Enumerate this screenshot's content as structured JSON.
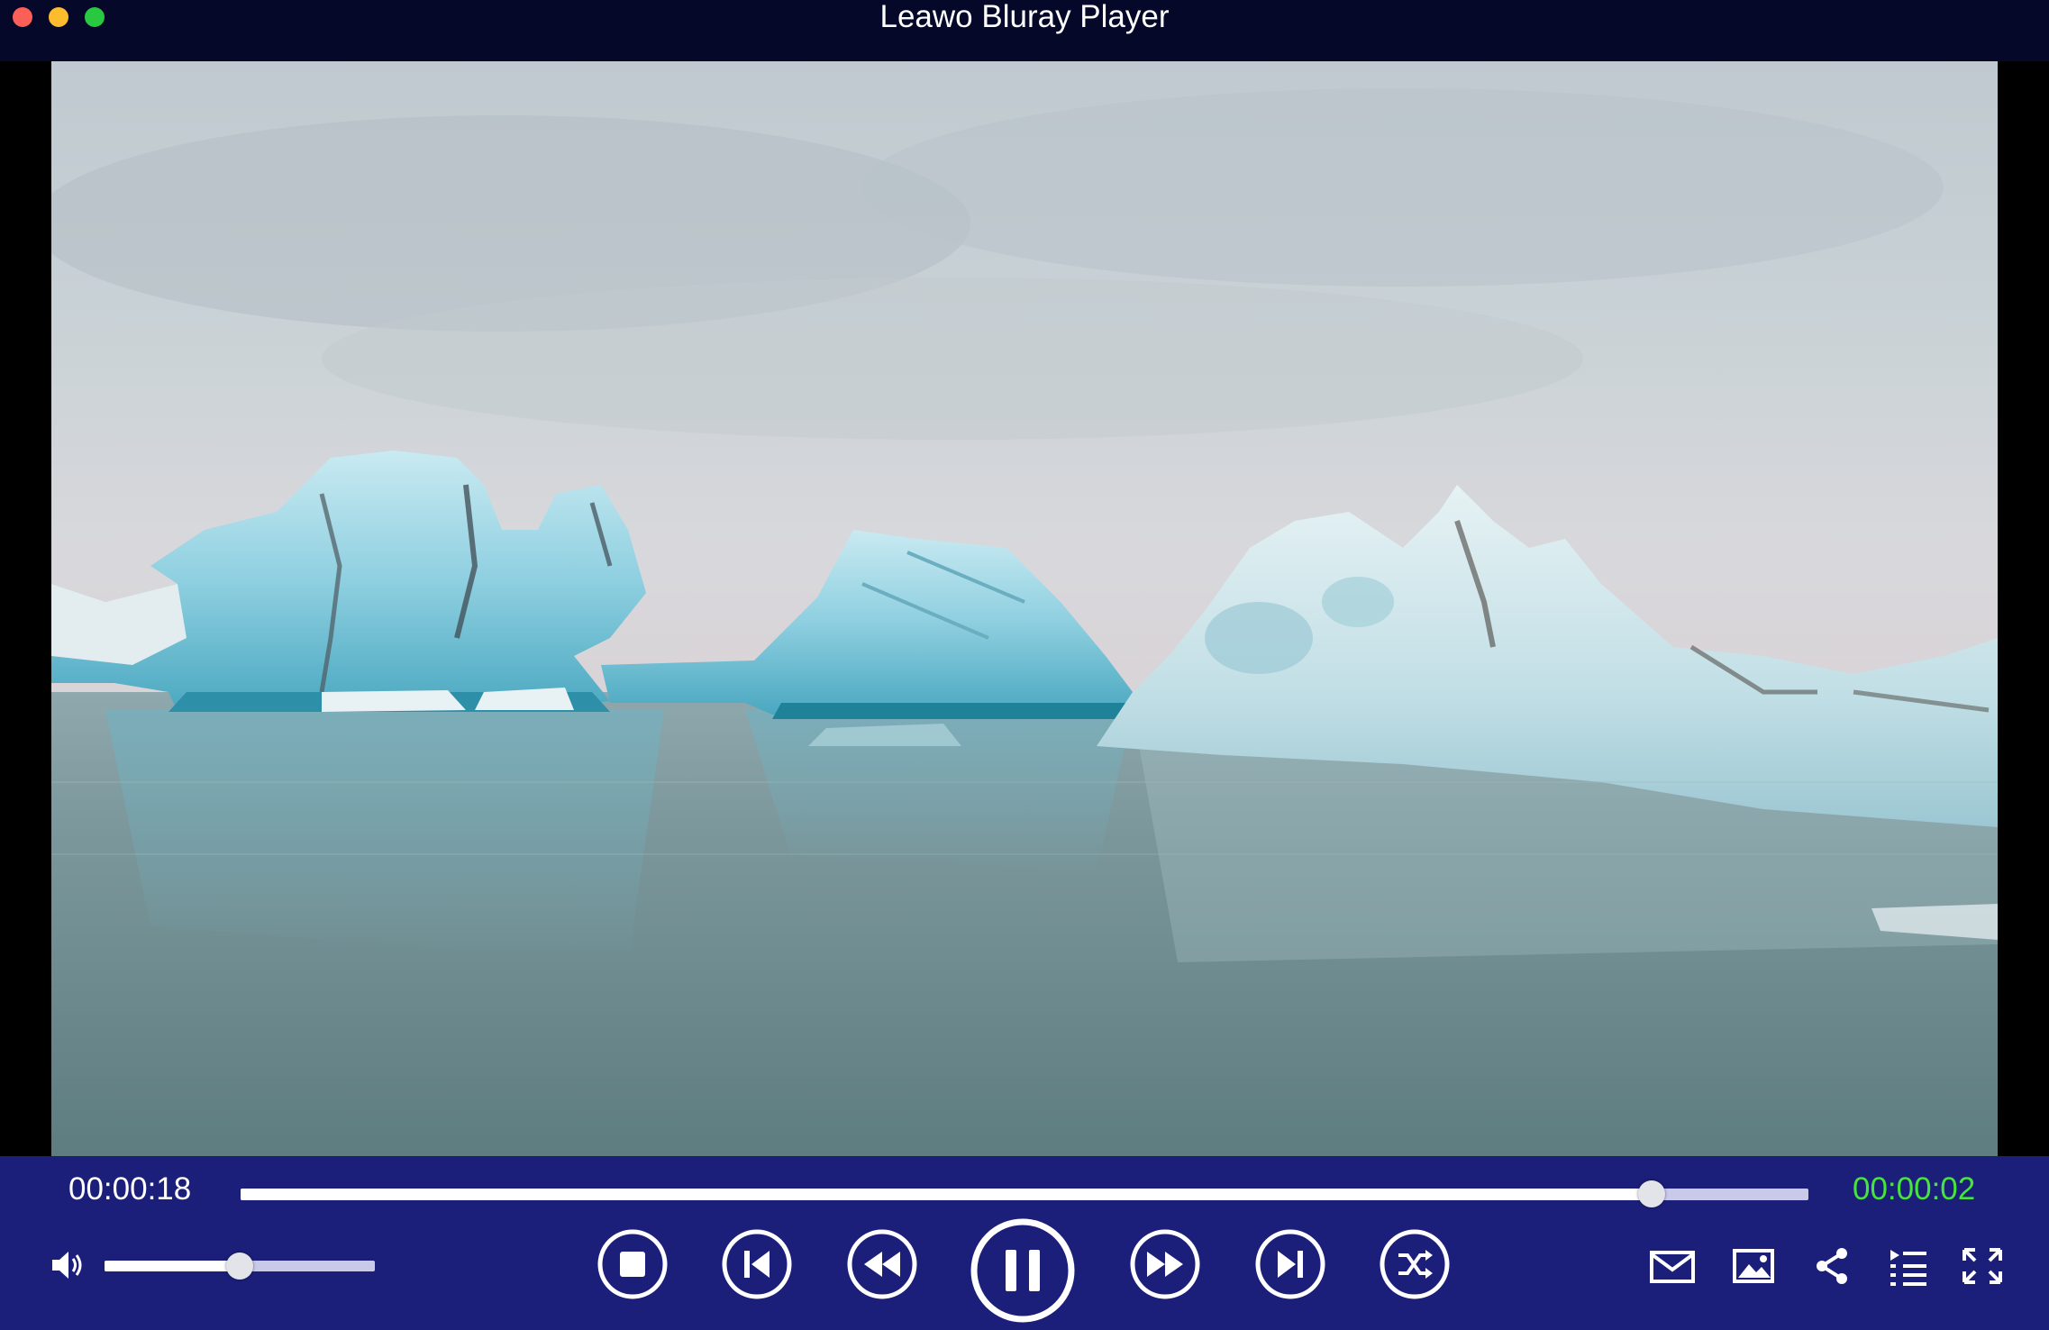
{
  "window": {
    "title": "Leawo Bluray Player"
  },
  "playback": {
    "elapsed": "00:00:18",
    "remaining": "00:00:02",
    "progress": 0.9,
    "volume": 0.5
  },
  "controls": {
    "left": [
      "volume-icon"
    ],
    "transport": [
      "stop-icon",
      "previous-icon",
      "rewind-icon",
      "pause-icon",
      "fast-forward-icon",
      "next-icon",
      "shuffle-icon"
    ],
    "right": [
      "mail-icon",
      "snapshot-icon",
      "share-icon",
      "playlist-icon",
      "fullscreen-icon"
    ]
  },
  "colors": {
    "titlebar": "#050828",
    "controlbar": "#1b1f7a",
    "remaining_time": "#46e43c",
    "close": "#fc5f57",
    "minimize": "#fdbc2e",
    "zoom": "#28c840"
  }
}
